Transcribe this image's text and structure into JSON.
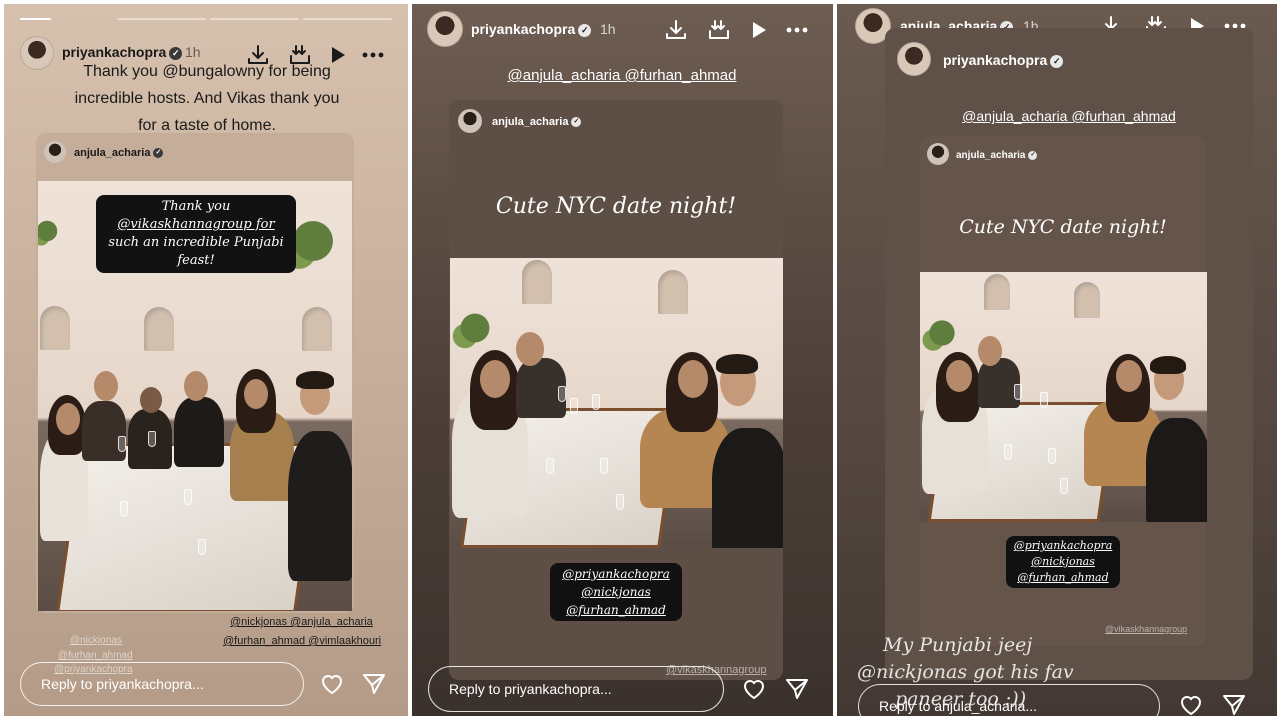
{
  "stories": [
    {
      "username": "priyankachopra",
      "time": "1h",
      "caption_lines": [
        "Thank you @bungalowny for being",
        "incredible hosts. And Vikas thank you",
        "for a taste of home."
      ],
      "shared_from": "anjula_acharia",
      "sticker_lines": [
        "Thank you",
        "@vikaskhannagroup for",
        "such an incredible Punjabi",
        "feast!"
      ],
      "tags_right": [
        "@nickjonas @anjula_acharia",
        "@furhan_ahmad @vimlaakhouri"
      ],
      "tags_ghost": [
        "@nickjonas",
        "@furhan_ahmad",
        "@priyankachopra"
      ],
      "reply_placeholder": "Reply to priyankachopra..."
    },
    {
      "username": "priyankachopra",
      "time": "1h",
      "mentions": "@anjula_acharia @furhan_ahmad",
      "shared_from": "anjula_acharia",
      "headline": "Cute NYC date night!",
      "pill_lines": [
        "@priyankachopra",
        "@nickjonas",
        "@furhan_ahmad"
      ],
      "ghost_tag": "@vikaskhannagroup",
      "reply_placeholder": "Reply to priyankachopra..."
    },
    {
      "username": "anjula_acharia",
      "time": "1h",
      "inner_username": "priyankachopra",
      "mentions": "@anjula_acharia @furhan_ahmad",
      "shared_from": "anjula_acharia",
      "headline": "Cute NYC date night!",
      "pill_lines": [
        "@priyankachopra",
        "@nickjonas",
        "@furhan_ahmad"
      ],
      "ghost_tag": "@vikaskhannagroup",
      "caption_lines": [
        "My Punjabi jeej",
        "@nickjonas got his fav",
        "paneer too :))"
      ],
      "reply_placeholder": "Reply to anjula_acharia..."
    }
  ],
  "icons": [
    "download-icon",
    "save-to-device-icon",
    "play-icon",
    "more-options-icon",
    "heart-icon",
    "send-icon",
    "verified-badge-icon"
  ],
  "colors": {
    "accent_white": "#ffffff",
    "pill_black": "#111111",
    "story1_bg": "#c8b19c",
    "story2_bg": "#4d4039",
    "story3_bg": "#544740"
  }
}
